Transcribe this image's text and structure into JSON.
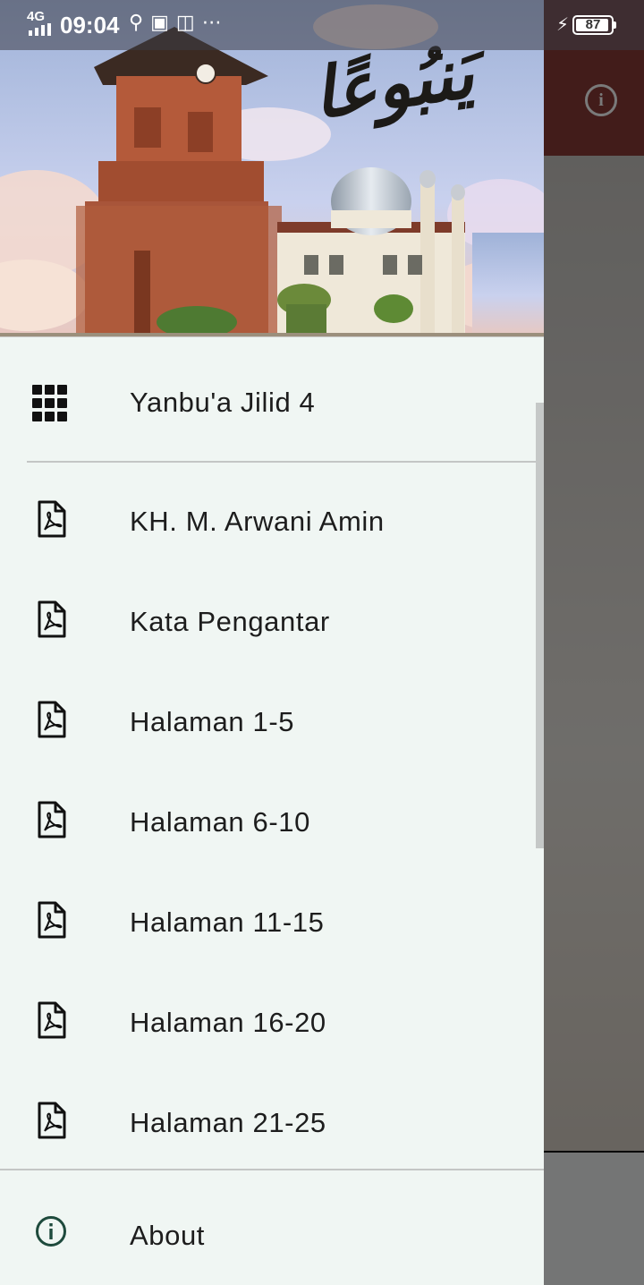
{
  "status_bar": {
    "network": "4G",
    "time": "09:04",
    "icons": [
      "usb-icon",
      "usb-debug-icon",
      "screenshot-icon",
      "more-dots-icon"
    ],
    "battery_percent": "87",
    "charging": true
  },
  "drawer": {
    "header_image": "mosque-minaret-header",
    "header_calligraphy": "يَنبُوعًا",
    "top_item": {
      "label": "Yanbu'a Jilid 4",
      "icon": "grid-icon"
    },
    "items": [
      {
        "label": "KH. M. Arwani Amin",
        "icon": "pdf-icon"
      },
      {
        "label": "Kata Pengantar",
        "icon": "pdf-icon"
      },
      {
        "label": "Halaman 1-5",
        "icon": "pdf-icon"
      },
      {
        "label": "Halaman 6-10",
        "icon": "pdf-icon"
      },
      {
        "label": "Halaman 11-15",
        "icon": "pdf-icon"
      },
      {
        "label": "Halaman 16-20",
        "icon": "pdf-icon"
      },
      {
        "label": "Halaman 21-25",
        "icon": "pdf-icon"
      }
    ],
    "bottom_item": {
      "label": "About",
      "icon": "info-icon"
    }
  },
  "background_app": {
    "toolbar_color": "#8a3b38",
    "action_icon": "info-icon"
  },
  "colors": {
    "drawer_bg": "#f0f6f3",
    "about_icon": "#1e4a3c",
    "scrim": "rgba(0,0,0,0.52)"
  }
}
